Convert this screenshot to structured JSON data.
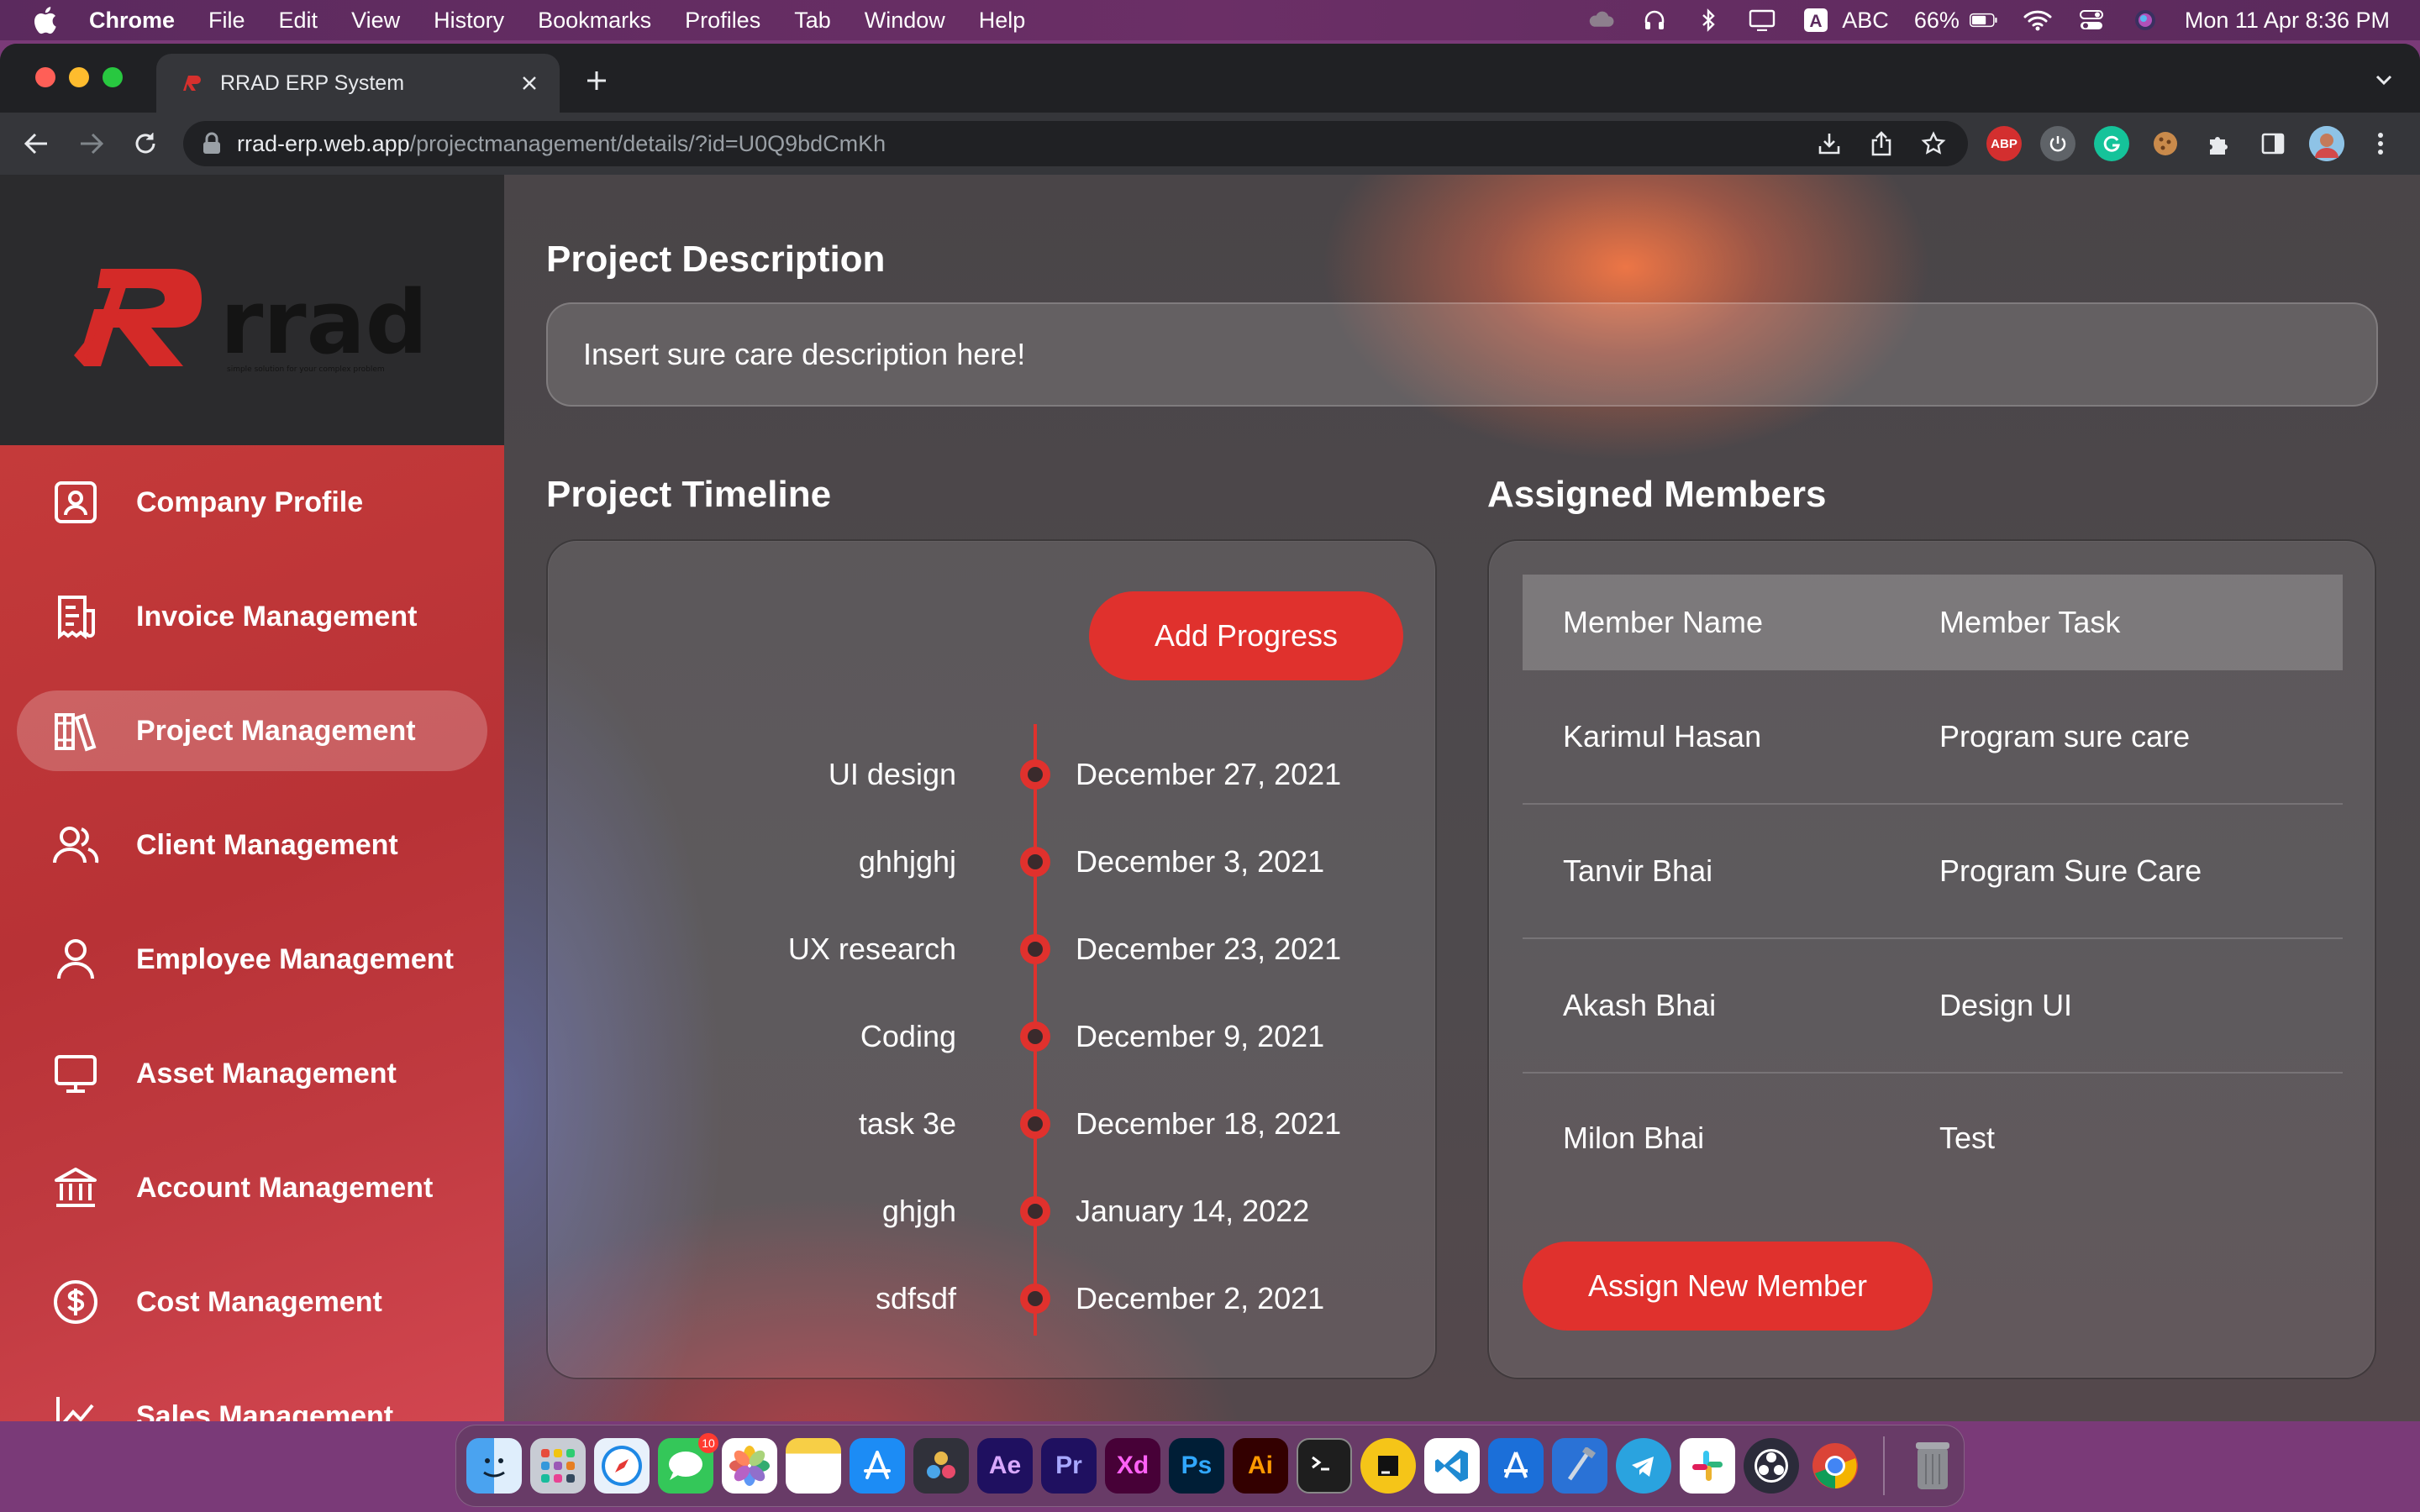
{
  "menubar": {
    "app_name": "Chrome",
    "items": [
      "File",
      "Edit",
      "View",
      "History",
      "Bookmarks",
      "Profiles",
      "Tab",
      "Window",
      "Help"
    ],
    "input_source": "ABC",
    "battery": "66%",
    "clock": "Mon 11 Apr  8:36 PM"
  },
  "browser": {
    "tab_title": "RRAD ERP System",
    "url_host": "rrad-erp.web.app",
    "url_path": "/projectmanagement/details/?id=U0Q9bdCmKh",
    "extension_abp": "ABP"
  },
  "sidebar": {
    "logo_text": "rrad",
    "logo_tagline": "simple solution for your complex problem",
    "items": [
      {
        "label": "Company Profile",
        "icon": "company-profile-icon"
      },
      {
        "label": "Invoice Management",
        "icon": "invoice-icon"
      },
      {
        "label": "Project Management",
        "icon": "books-icon",
        "active": true
      },
      {
        "label": "Client Management",
        "icon": "users-icon"
      },
      {
        "label": "Employee Management",
        "icon": "user-icon"
      },
      {
        "label": "Asset Management",
        "icon": "monitor-icon"
      },
      {
        "label": "Account Management",
        "icon": "bank-icon"
      },
      {
        "label": "Cost Management",
        "icon": "dollar-circle-icon"
      },
      {
        "label": "Sales Management",
        "icon": "chart-line-icon"
      }
    ]
  },
  "project": {
    "description_title": "Project Description",
    "description": "Insert sure care description here!",
    "timeline_title": "Project Timeline",
    "add_progress_label": "Add Progress",
    "timeline": [
      {
        "task": "UI design",
        "date": "December 27, 2021"
      },
      {
        "task": "ghhjghj",
        "date": "December 3, 2021"
      },
      {
        "task": "UX research",
        "date": "December 23, 2021"
      },
      {
        "task": "Coding",
        "date": "December 9, 2021"
      },
      {
        "task": "task 3e",
        "date": "December 18, 2021"
      },
      {
        "task": "ghjgh",
        "date": "January 14, 2022"
      },
      {
        "task": "sdfsdf",
        "date": "December 2, 2021"
      }
    ],
    "members_title": "Assigned Members",
    "members_headers": [
      "Member Name",
      "Member Task"
    ],
    "members": [
      {
        "name": "Karimul Hasan",
        "task": "Program sure care"
      },
      {
        "name": "Tanvir Bhai",
        "task": "Program Sure Care"
      },
      {
        "name": "Akash Bhai",
        "task": "Design UI"
      },
      {
        "name": "Milon Bhai",
        "task": "Test"
      }
    ],
    "assign_label": "Assign New Member"
  },
  "dock": {
    "messages_badge": "10",
    "apps": [
      "Finder",
      "Launchpad",
      "Safari",
      "Messages",
      "Photos",
      "Notes",
      "App Store",
      "DaVinci Resolve",
      "After Effects",
      "Premiere Pro",
      "Adobe XD",
      "Photoshop",
      "Illustrator",
      "Terminal",
      "Toolbox",
      "VS Code",
      "Xcode Instruments",
      "Xcode",
      "Telegram",
      "Slack",
      "OBS",
      "Chrome",
      "Trash"
    ]
  },
  "colors": {
    "accent_red": "#e0312d",
    "sidebar_red": "#c43a3a",
    "logo_bg": "#2b2b2d"
  }
}
